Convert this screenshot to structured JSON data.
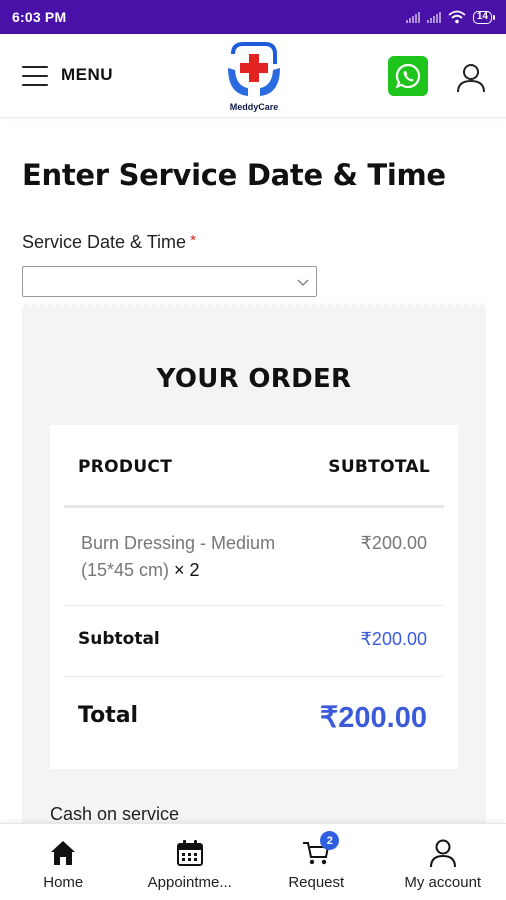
{
  "status_bar": {
    "time": "6:03 PM",
    "battery": "14"
  },
  "header": {
    "menu_label": "MENU",
    "logo_text": "MeddyCare",
    "whatsapp_icon": "whatsapp-icon",
    "account_icon": "user-icon"
  },
  "main": {
    "title": "Enter Service Date & Time",
    "date_field": {
      "label": "Service Date & Time",
      "required_mark": "*",
      "value": ""
    }
  },
  "order": {
    "title": "YOUR ORDER",
    "columns": {
      "product": "PRODUCT",
      "subtotal": "SUBTOTAL"
    },
    "items": [
      {
        "name": "Burn Dressing - Medium (15*45 cm)",
        "qty": "× 2",
        "price": "₹200.00"
      }
    ],
    "subtotal_label": "Subtotal",
    "subtotal_value": "₹200.00",
    "total_label": "Total",
    "total_value": "₹200.00",
    "payment_method": "Cash on service"
  },
  "bottom_nav": {
    "items": [
      {
        "label": "Home",
        "icon": "home-icon"
      },
      {
        "label": "Appointme...",
        "icon": "calendar-icon"
      },
      {
        "label": "Request",
        "icon": "cart-icon",
        "badge": "2"
      },
      {
        "label": "My account",
        "icon": "user-icon"
      }
    ]
  },
  "colors": {
    "status_bar": "#4a11a8",
    "accent_blue": "#3b5bdb",
    "whatsapp_green": "#1ec31c",
    "required_red": "#e2261c",
    "panel_bg": "#f4f4f6",
    "badge_blue": "#2f5fe0"
  }
}
